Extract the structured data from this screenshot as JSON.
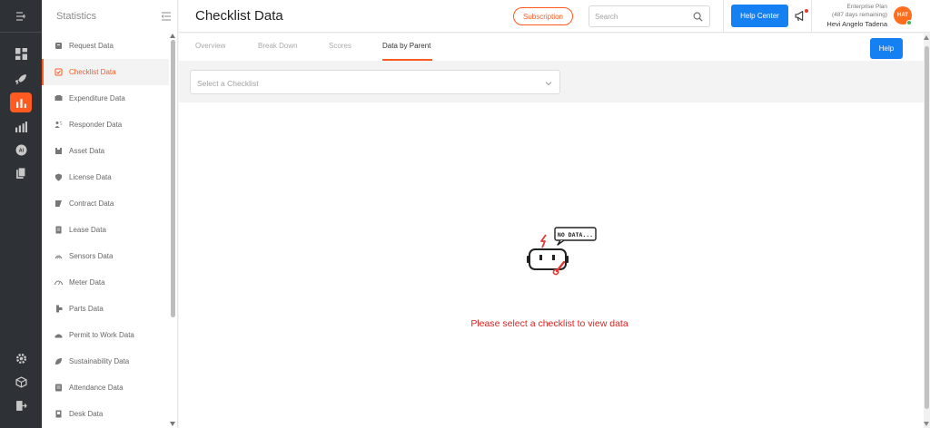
{
  "sidebar": {
    "title": "Statistics",
    "items": [
      {
        "label": "Request Data",
        "icon": "request-icon"
      },
      {
        "label": "Checklist Data",
        "icon": "checklist-icon",
        "active": true
      },
      {
        "label": "Expenditure Data",
        "icon": "expenditure-icon"
      },
      {
        "label": "Responder Data",
        "icon": "responder-icon"
      },
      {
        "label": "Asset Data",
        "icon": "asset-icon"
      },
      {
        "label": "License Data",
        "icon": "license-icon"
      },
      {
        "label": "Contract Data",
        "icon": "contract-icon"
      },
      {
        "label": "Lease Data",
        "icon": "lease-icon"
      },
      {
        "label": "Sensors Data",
        "icon": "sensors-icon"
      },
      {
        "label": "Meter Data",
        "icon": "meter-icon"
      },
      {
        "label": "Parts Data",
        "icon": "parts-icon"
      },
      {
        "label": "Permit to Work Data",
        "icon": "permit-icon"
      },
      {
        "label": "Sustainability Data",
        "icon": "sustainability-icon"
      },
      {
        "label": "Attendance Data",
        "icon": "attendance-icon"
      },
      {
        "label": "Desk Data",
        "icon": "desk-icon"
      }
    ]
  },
  "header": {
    "title": "Checklist Data",
    "subscription_label": "Subscription",
    "search_placeholder": "Search",
    "help_center_label": "Help Center",
    "plan_name": "Enterprise Plan",
    "plan_days": "(487 days remaining)",
    "user_name": "Hevi Angelo Tadena",
    "avatar_initials": "HAT"
  },
  "tabs": [
    {
      "label": "Overview"
    },
    {
      "label": "Break Down"
    },
    {
      "label": "Scores"
    },
    {
      "label": "Data by Parent",
      "active": true
    }
  ],
  "help_label": "Help",
  "filter": {
    "placeholder": "Select a Checklist"
  },
  "empty_state": {
    "bubble_text": "NO DATA...",
    "message": "Please select a checklist to view data"
  },
  "colors": {
    "accent": "#ff5a1f",
    "primary_button": "#1580f2",
    "rail_bg": "#2e3236",
    "error_text": "#e11f1f"
  }
}
